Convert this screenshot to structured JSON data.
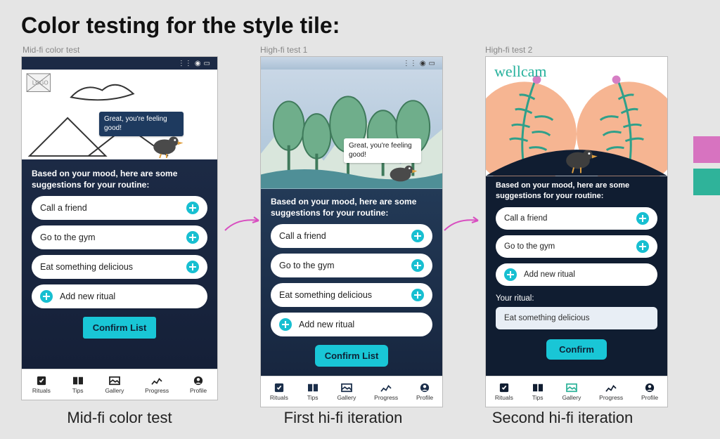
{
  "title": "Color testing for the style tile:",
  "column_labels": [
    "Mid-fi color test",
    "High-fi test 1",
    "High-fi test 2"
  ],
  "captions": [
    "Mid-fi color test",
    "First hi-fi iteration",
    "Second hi-fi iteration"
  ],
  "swatches": {
    "pink": "#d773c0",
    "teal": "#2fb39a"
  },
  "common": {
    "speech": "Great, you're feeling good!",
    "prompt": "Based on your mood, here are some suggestions for your routine:",
    "suggestions": [
      "Call a friend",
      "Go to the gym",
      "Eat something delicious"
    ],
    "add_new": "Add new ritual",
    "confirm": "Confirm List",
    "tabs": [
      "Rituals",
      "Tips",
      "Gallery",
      "Progress",
      "Profile"
    ]
  },
  "midfi": {
    "logo_placeholder": "LOGO"
  },
  "hifi2": {
    "brand": "wellcam",
    "suggestions": [
      "Call a friend",
      "Go to the gym"
    ],
    "your_ritual_label": "Your ritual:",
    "your_ritual_value": "Eat something delicious",
    "confirm": "Confirm"
  }
}
